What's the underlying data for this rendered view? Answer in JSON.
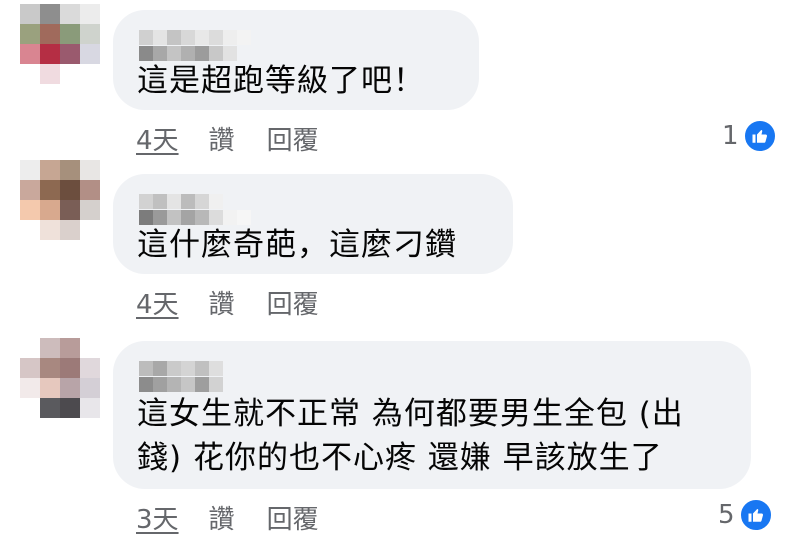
{
  "comments": [
    {
      "text_lines": [
        "這是超跑等級了吧！"
      ],
      "time": "4天",
      "like_label": "讚",
      "reply_label": "回覆",
      "reaction_count": "1"
    },
    {
      "text_lines": [
        "這什麼奇葩，這麼刁鑽"
      ],
      "time": "4天",
      "like_label": "讚",
      "reply_label": "回覆",
      "reaction_count": ""
    },
    {
      "text_lines": [
        "這女生就不正常 為何都要男生全包 (出",
        "錢) 花你的也不心疼 還嫌 早該放生了"
      ],
      "time": "3天",
      "like_label": "讚",
      "reply_label": "回覆",
      "reaction_count": "5"
    }
  ],
  "colors": {
    "bubble": "#f0f2f5",
    "meta_text": "#65676b",
    "like_blue": "#1877f2"
  },
  "icons": {
    "reaction": "thumbs-up-icon"
  }
}
